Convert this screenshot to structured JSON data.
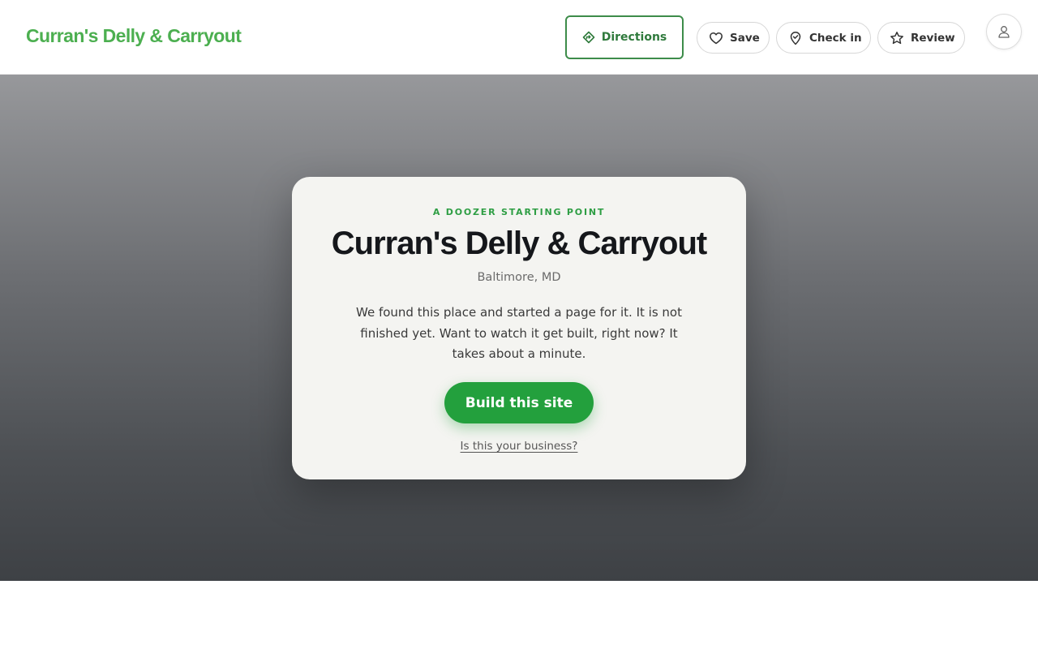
{
  "header": {
    "brand": "Curran's Delly & Carryout",
    "directions_label": "Directions",
    "save_label": "Save",
    "checkin_label": "Check in",
    "review_label": "Review",
    "icons": {
      "directions": "directions-icon",
      "save": "heart-icon",
      "checkin": "map-pin-icon",
      "review": "star-icon",
      "account": "user-icon"
    }
  },
  "card": {
    "eyebrow": "A DOOZER STARTING POINT",
    "title": "Curran's Delly & Carryout",
    "location": "Baltimore, MD",
    "description": "We found this place and started a page for it. It is not finished yet. Want to watch it get built, right now? It takes about a minute.",
    "cta_label": "Build this site",
    "claim_link": "Is this your business?"
  },
  "colors": {
    "brand": "#4caf50",
    "accent": "#23a03d",
    "eyebrow": "#2e9e44",
    "directions_border": "#3d8c4a",
    "title": "#15171b",
    "hero_top": "#97989b",
    "hero_bottom": "#3e4145",
    "card_bg": "#f4f4f1"
  }
}
